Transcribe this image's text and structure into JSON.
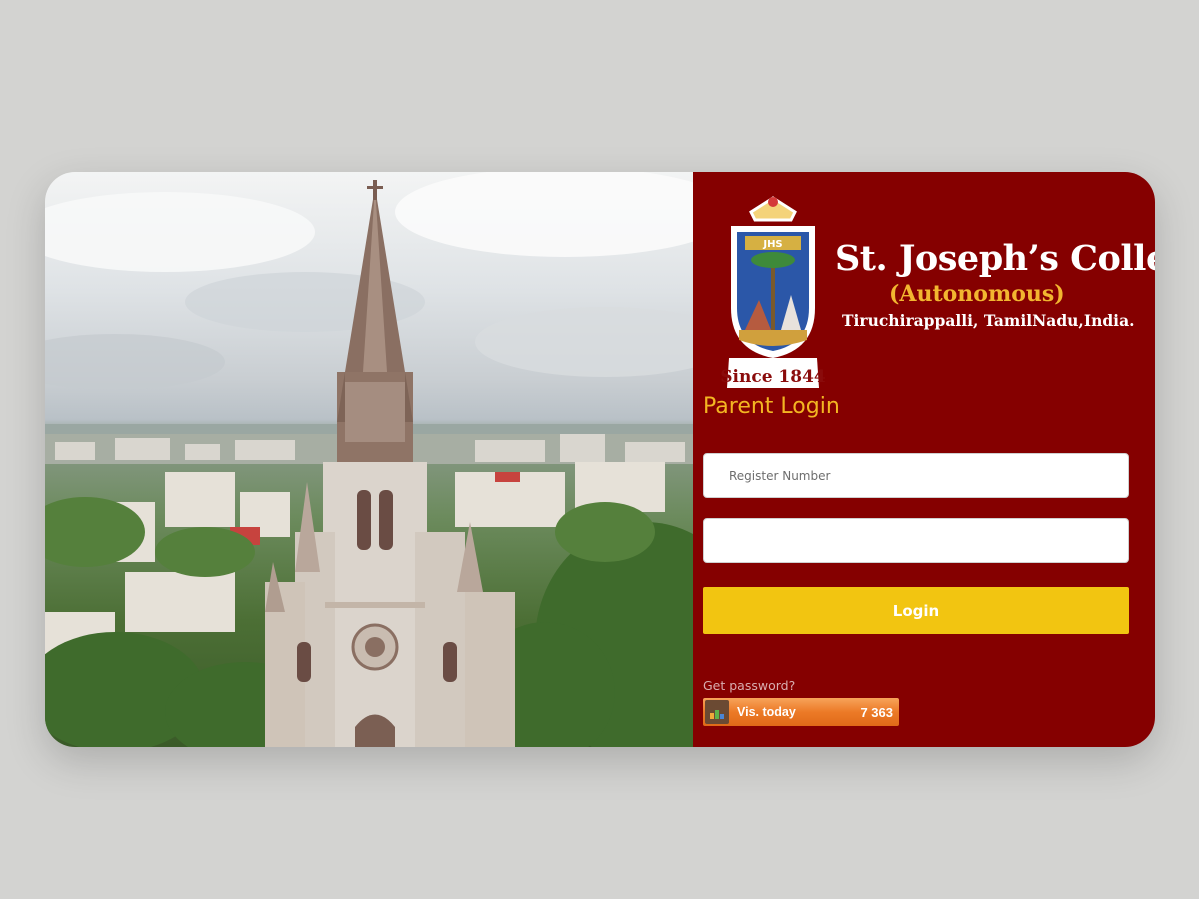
{
  "photo": {
    "icon": "cathedral-campus-photo"
  },
  "brand": {
    "title": "St. Joseph’s College",
    "subtitle": "(Autonomous)",
    "location": "Tiruchirappalli, TamilNadu,India.",
    "crest_initials": "JHS",
    "since": "Since 1844",
    "colors": {
      "panel": "#850000",
      "accent": "#f3b622",
      "title": "#ffffff"
    }
  },
  "login": {
    "heading": "Parent Login",
    "register_placeholder": "Register Number",
    "register_value": "",
    "password_placeholder": "",
    "password_value": "",
    "button_label": "Login",
    "button_color": "#f2c511",
    "get_password_label": "Get password?"
  },
  "counter": {
    "label": "Vis. today",
    "count": "7 363",
    "icon": "stats-bars-icon"
  }
}
